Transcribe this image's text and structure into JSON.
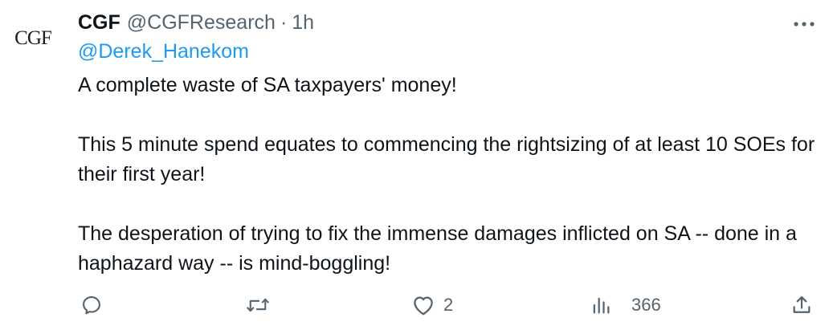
{
  "tweet": {
    "avatar_text": "CGF",
    "display_name": "CGF",
    "handle": "@CGFResearch",
    "separator": "·",
    "time": "1h",
    "reply_mention": "@Derek_Hanekom",
    "paragraphs": [
      "A complete waste of SA taxpayers' money!",
      "This 5 minute spend equates to commencing the rightsizing of at least 10 SOEs for their first year!",
      "The desperation of trying to fix the immense damages inflicted on SA -- done in a haphazard way -- is mind-boggling!"
    ],
    "actions": {
      "reply_icon": "reply-icon",
      "retweet_icon": "retweet-icon",
      "like_icon": "heart-icon",
      "like_count": "2",
      "views_icon": "views-icon",
      "views_count": "366",
      "share_icon": "share-icon"
    },
    "colors": {
      "text": "#0f1419",
      "muted": "#536471",
      "link": "#1d9bf0"
    }
  }
}
